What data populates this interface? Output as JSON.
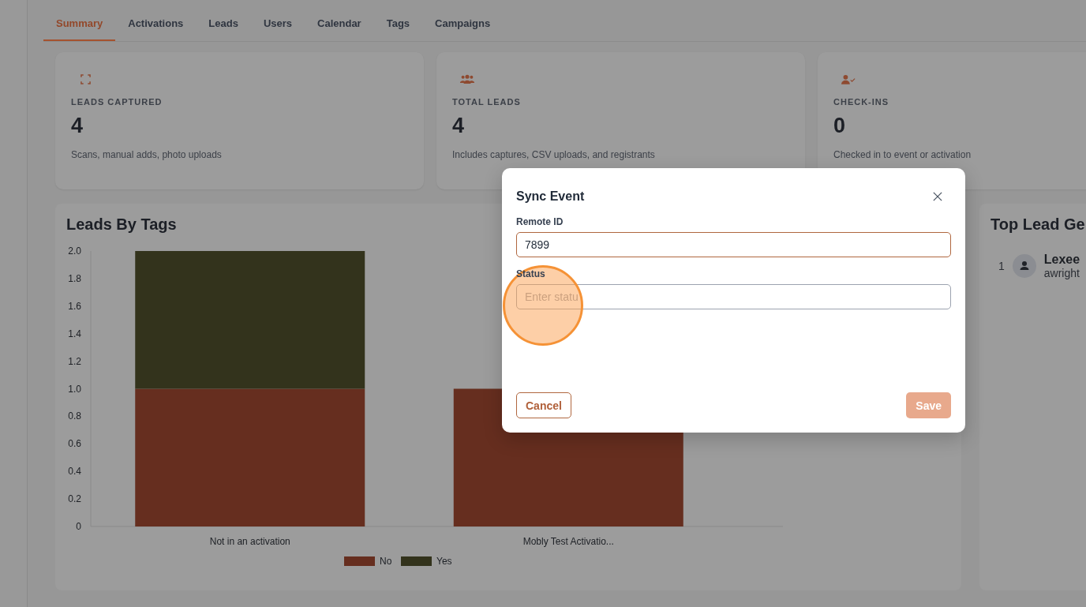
{
  "tabs": [
    {
      "label": "Summary",
      "selected": true
    },
    {
      "label": "Activations",
      "selected": false
    },
    {
      "label": "Leads",
      "selected": false
    },
    {
      "label": "Users",
      "selected": false
    },
    {
      "label": "Calendar",
      "selected": false
    },
    {
      "label": "Tags",
      "selected": false
    },
    {
      "label": "Campaigns",
      "selected": false
    }
  ],
  "stats": [
    {
      "kind": "scan",
      "label": "LEADS CAPTURED",
      "value": "4",
      "note": "Scans, manual adds, photo uploads"
    },
    {
      "kind": "group",
      "label": "TOTAL LEADS",
      "value": "4",
      "note": "Includes captures, CSV uploads, and registrants"
    },
    {
      "kind": "checkin",
      "label": "CHECK-INS",
      "value": "0",
      "note": "Checked in to event or activation"
    }
  ],
  "leads_by_tags": {
    "title": "Leads By Tags",
    "chart_data": {
      "type": "bar",
      "stacked": true,
      "categories": [
        "Not in an activation",
        "Mobly Test Activatio..."
      ],
      "ylim": [
        0,
        2
      ],
      "yticks": [
        {
          "value": 0,
          "label": "0"
        },
        {
          "value": 0.2,
          "label": "0.2"
        },
        {
          "value": 0.4,
          "label": "0.4"
        },
        {
          "value": 0.6,
          "label": "0.6"
        },
        {
          "value": 0.8,
          "label": "0.8"
        },
        {
          "value": 1,
          "label": "1.0"
        },
        {
          "value": 1.2,
          "label": "1.2"
        },
        {
          "value": 1.4,
          "label": "1.4"
        },
        {
          "value": 1.6,
          "label": "1.6"
        },
        {
          "value": 1.8,
          "label": "1.8"
        },
        {
          "value": 2,
          "label": "2.0"
        }
      ],
      "series": [
        {
          "name": "No",
          "color": "#662e1f",
          "values": [
            1,
            1
          ]
        },
        {
          "name": "Yes",
          "color": "#33331c",
          "values": [
            1,
            0
          ]
        }
      ],
      "legend": "bottom"
    }
  },
  "top_lead_generators": {
    "title": "Top Lead Ge",
    "rows": [
      {
        "rank": "1",
        "name": "Lexee",
        "email": "awright"
      }
    ]
  },
  "dialog": {
    "title": "Sync Event",
    "fields": [
      {
        "label": "Remote ID",
        "value": "7899",
        "focused": true
      },
      {
        "label": "Status",
        "placeholder": "Enter statu",
        "focused": false
      }
    ],
    "cancel": "Cancel",
    "save": {
      "label": "Save",
      "disabled": true
    }
  }
}
